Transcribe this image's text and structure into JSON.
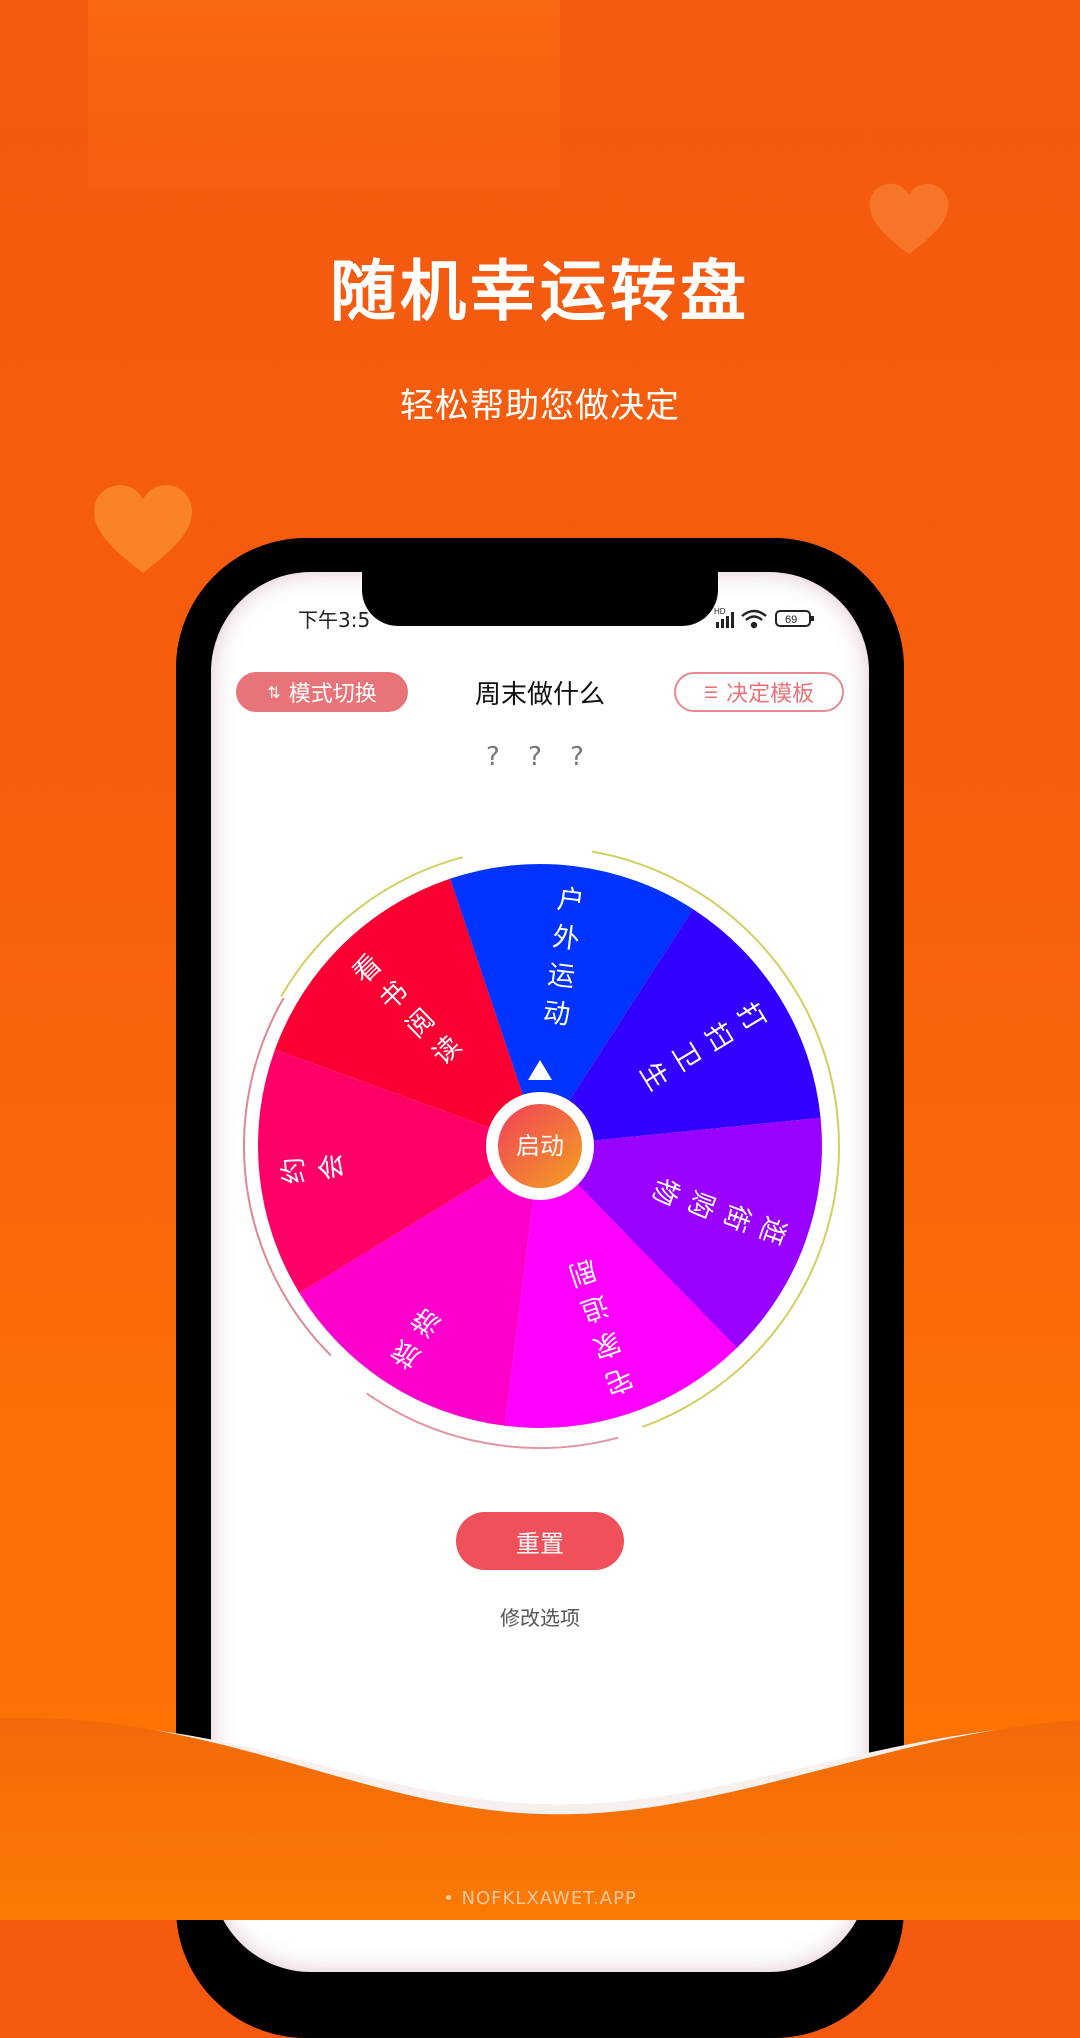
{
  "promo": {
    "headline": "随机幸运转盘",
    "subline": "轻松帮助您做决定",
    "footer_url": "• NOFKLXAWET.APP",
    "background_color": "#f45a10"
  },
  "status_bar": {
    "time": "下午3:5",
    "battery": "69",
    "network": "HD"
  },
  "app": {
    "mode_button": {
      "icon": "swap-icon",
      "label": "模式切换"
    },
    "title": "周末做什么",
    "template_button": {
      "icon": "list-icon",
      "label": "决定模板"
    },
    "result": "? ? ?",
    "start_label": "启动",
    "reset_label": "重置",
    "edit_label": "修改选项"
  },
  "wheel": {
    "segments": [
      {
        "label": "看书阅读",
        "color": "#fa0032"
      },
      {
        "label": "户外运动",
        "color": "#0033ff"
      },
      {
        "label": "打扫卫生",
        "color": "#3300ff"
      },
      {
        "label": "逛街购物",
        "color": "#9900ff"
      },
      {
        "label": "宅家追剧",
        "color": "#ff00ff"
      },
      {
        "label": "旅游",
        "color": "#ff00cc"
      },
      {
        "label": "约会",
        "color": "#ff0066"
      }
    ]
  }
}
